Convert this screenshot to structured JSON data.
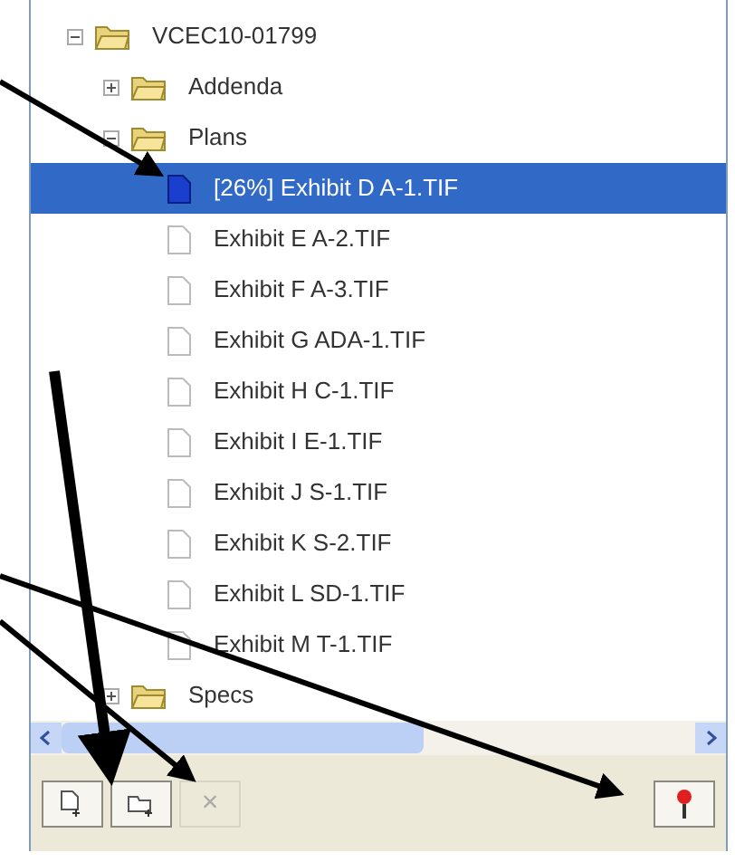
{
  "tree": [
    {
      "kind": "folder",
      "label": "VCEC10-01799",
      "expanded": true,
      "selected": false,
      "children": [
        {
          "kind": "folder",
          "label": "Addenda",
          "expanded": false,
          "selected": false
        },
        {
          "kind": "folder",
          "label": "Plans",
          "expanded": true,
          "selected": false,
          "children": [
            {
              "kind": "file",
              "label": "[26%] Exhibit D A-1.TIF",
              "selected": true
            },
            {
              "kind": "file",
              "label": "Exhibit E A-2.TIF",
              "selected": false
            },
            {
              "kind": "file",
              "label": "Exhibit F A-3.TIF",
              "selected": false
            },
            {
              "kind": "file",
              "label": "Exhibit G ADA-1.TIF",
              "selected": false
            },
            {
              "kind": "file",
              "label": "Exhibit H C-1.TIF",
              "selected": false
            },
            {
              "kind": "file",
              "label": "Exhibit I E-1.TIF",
              "selected": false
            },
            {
              "kind": "file",
              "label": "Exhibit J S-1.TIF",
              "selected": false
            },
            {
              "kind": "file",
              "label": "Exhibit K S-2.TIF",
              "selected": false
            },
            {
              "kind": "file",
              "label": "Exhibit L SD-1.TIF",
              "selected": false
            },
            {
              "kind": "file",
              "label": "Exhibit M T-1.TIF",
              "selected": false
            }
          ]
        },
        {
          "kind": "folder",
          "label": "Specs",
          "expanded": false,
          "selected": false
        }
      ]
    }
  ],
  "toolbar": [
    {
      "kind": "add-file",
      "disabled": false
    },
    {
      "kind": "add-folder",
      "disabled": false
    },
    {
      "kind": "delete",
      "label": "×",
      "disabled": true
    },
    {
      "kind": "pin",
      "disabled": false
    }
  ]
}
